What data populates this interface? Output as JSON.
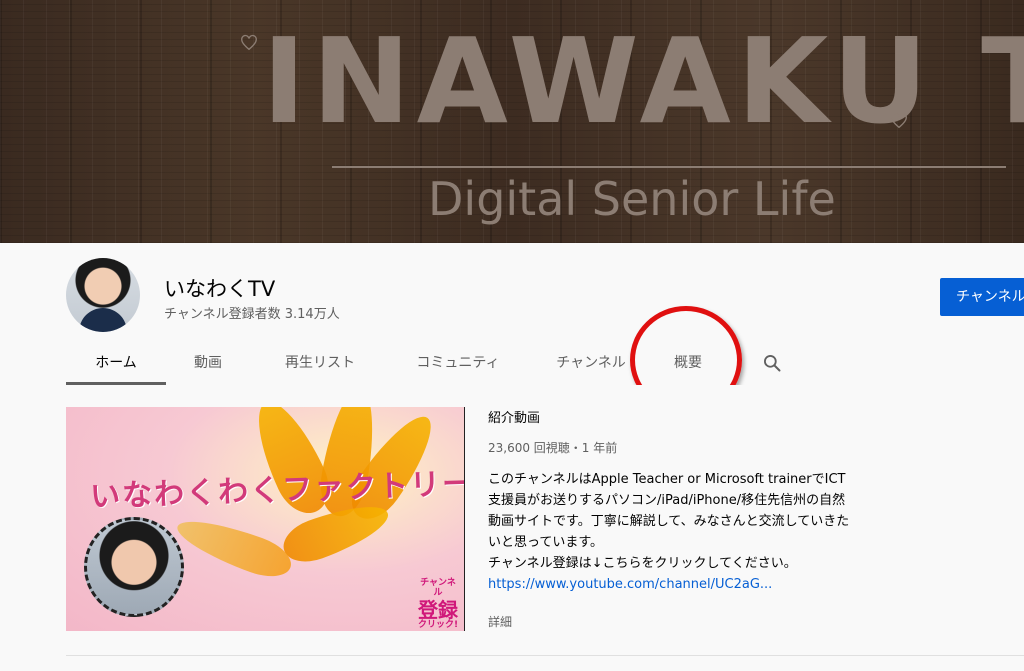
{
  "banner": {
    "title": "INAWAKU TV",
    "subtitle": "Digital Senior Life"
  },
  "channel": {
    "name": "いなわくTV",
    "subscribers": "チャンネル登録者数 3.14万人",
    "subscribe_button": "チャンネル登録"
  },
  "tabs": [
    {
      "label": "ホーム",
      "active": true
    },
    {
      "label": "動画"
    },
    {
      "label": "再生リスト"
    },
    {
      "label": "コミュニティ"
    },
    {
      "label": "チャンネル"
    },
    {
      "label": "概要"
    }
  ],
  "icons": {
    "search": "search-icon",
    "heart": "heart-icon"
  },
  "annotation_color": "#e01010",
  "featured": {
    "thumbnail_title": "いなわくわくファクトリー",
    "thumbnail_cta_small": "チャンネル",
    "thumbnail_cta_big": "登録",
    "thumbnail_cta_tail": "クリック!",
    "label": "紹介動画",
    "meta": "23,600 回視聴・1 年前",
    "description_1": "このチャンネルはApple Teacher or Microsoft trainerでICT支援員がお送りするパソコン/iPad/iPhone/移住先信州の自然動画サイトです。丁寧に解説して、みなさんと交流していきたいと思っています。",
    "description_2": "チャンネル登録は↓こちらをクリックしてください。",
    "link": "https://www.youtube.com/channel/UC2aG...",
    "more": "詳細"
  },
  "colors": {
    "accent": "#065fd4",
    "text_secondary": "#606060"
  }
}
